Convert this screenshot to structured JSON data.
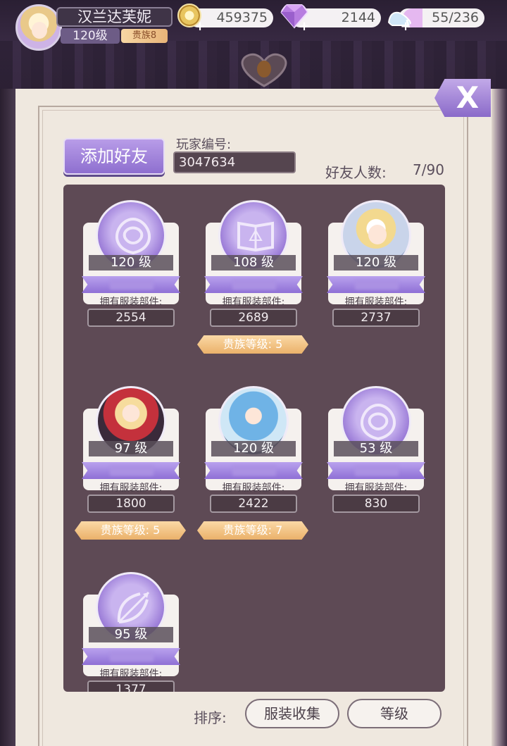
{
  "header": {
    "player_name": "汉兰达芙妮",
    "player_level": "120级",
    "noble_rank": "贵族8",
    "gold": "459375",
    "diamonds": "2144",
    "stamina": "55/236",
    "stamina_fraction": 0.23
  },
  "panel": {
    "close_label": "X",
    "add_friend_label": "添加好友",
    "player_id_label": "玩家编号:",
    "player_id_value": "3047634",
    "friend_count_label": "好友人数:",
    "friend_count_value": "7/90",
    "sort_label": "排序:",
    "sort_options": [
      "服装收集",
      "等级"
    ]
  },
  "friends": [
    {
      "level": "120 级",
      "parts_label": "拥有服装部件:",
      "parts": "2554",
      "portrait_icon": "rose-icon",
      "noble": ""
    },
    {
      "level": "108 级",
      "parts_label": "拥有服装部件:",
      "parts": "2689",
      "portrait_icon": "book-icon",
      "noble": "贵族等级: 5"
    },
    {
      "level": "120 级",
      "parts_label": "拥有服装部件:",
      "parts": "2737",
      "portrait_icon": "blonde-character-avatar",
      "noble": ""
    },
    {
      "level": "97 级",
      "parts_label": "拥有服装部件:",
      "parts": "1800",
      "portrait_icon": "red-hat-character-avatar",
      "noble": "贵族等级: 5"
    },
    {
      "level": "120 级",
      "parts_label": "拥有服装部件:",
      "parts": "2422",
      "portrait_icon": "blue-hair-character-avatar",
      "noble": "贵族等级: 7"
    },
    {
      "level": "53 级",
      "parts_label": "拥有服装部件:",
      "parts": "830",
      "portrait_icon": "rose-icon",
      "noble": ""
    },
    {
      "level": "95 级",
      "parts_label": "拥有服装部件:",
      "parts": "1377",
      "portrait_icon": "bow-arrow-icon",
      "noble": ""
    }
  ],
  "colors": {
    "accent_purple": "#9b7ddb",
    "noble_gold": "#efb877",
    "page_bg": "#efe8df",
    "list_bg": "#5e4a55"
  }
}
